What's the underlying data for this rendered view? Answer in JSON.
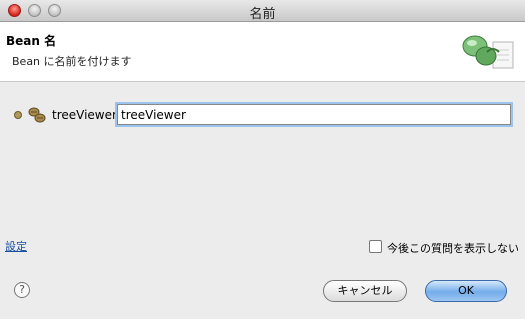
{
  "window": {
    "title": "名前"
  },
  "header": {
    "title": "Bean 名",
    "description": "Bean に名前を付けます"
  },
  "icons": {
    "wizard": "bean-wizard-icon",
    "property": "property-dot-icon",
    "bean": "beans-icon",
    "help": "help-icon"
  },
  "field": {
    "label": "treeViewer",
    "value": "treeViewer"
  },
  "footer": {
    "settings_link": "設定",
    "dont_ask_label": "今後この質問を表示しない",
    "dont_ask_checked": false,
    "help_glyph": "?",
    "cancel_label": "キャンセル",
    "ok_label": "OK"
  },
  "colors": {
    "accent": "#74acea",
    "link": "#1a4ea0",
    "close": "#d6241a"
  }
}
